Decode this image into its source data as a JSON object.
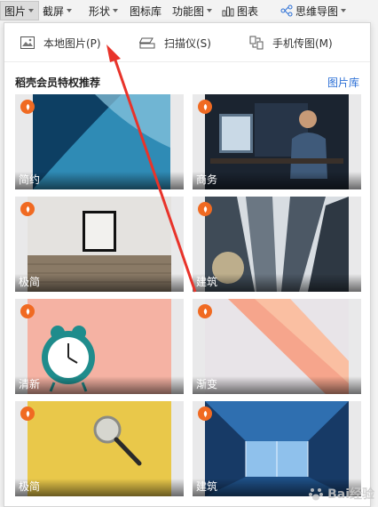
{
  "ribbon": {
    "items": [
      {
        "label": "图片",
        "has_caret": true,
        "active": true
      },
      {
        "label": "截屏",
        "has_caret": true
      },
      {
        "label": "形状",
        "has_caret": true
      },
      {
        "label": "图标库",
        "has_caret": false
      },
      {
        "label": "功能图",
        "has_caret": true
      },
      {
        "label": "图表",
        "has_caret": false,
        "icon": "bar-chart-icon"
      },
      {
        "label": "思维导图",
        "has_caret": true,
        "icon": "mindmap-icon"
      }
    ]
  },
  "panel": {
    "actions": [
      {
        "label": "本地图片(P)",
        "icon": "image-icon"
      },
      {
        "label": "扫描仪(S)",
        "icon": "scanner-icon"
      },
      {
        "label": "手机传图(M)",
        "icon": "phone-transfer-icon"
      }
    ],
    "section_title": "稻壳会员特权推荐",
    "library_link": "图片库",
    "tiles": [
      {
        "label": "简约",
        "badge": "docer-badge-icon"
      },
      {
        "label": "商务",
        "badge": "docer-badge-icon"
      },
      {
        "label": "极简",
        "badge": "docer-badge-icon"
      },
      {
        "label": "建筑",
        "badge": "docer-badge-icon"
      },
      {
        "label": "清新",
        "badge": "docer-badge-icon"
      },
      {
        "label": "渐变",
        "badge": "docer-badge-icon"
      },
      {
        "label": "极简",
        "badge": "docer-badge-icon"
      },
      {
        "label": "建筑",
        "badge": "docer-badge-icon"
      }
    ]
  },
  "watermark": {
    "text": "Bai经验",
    "sub": "jingyan.baidu.com"
  },
  "colors": {
    "accent_link": "#2b6fd6",
    "badge": "#f06a22",
    "annotation_arrow": "#e8332a"
  }
}
